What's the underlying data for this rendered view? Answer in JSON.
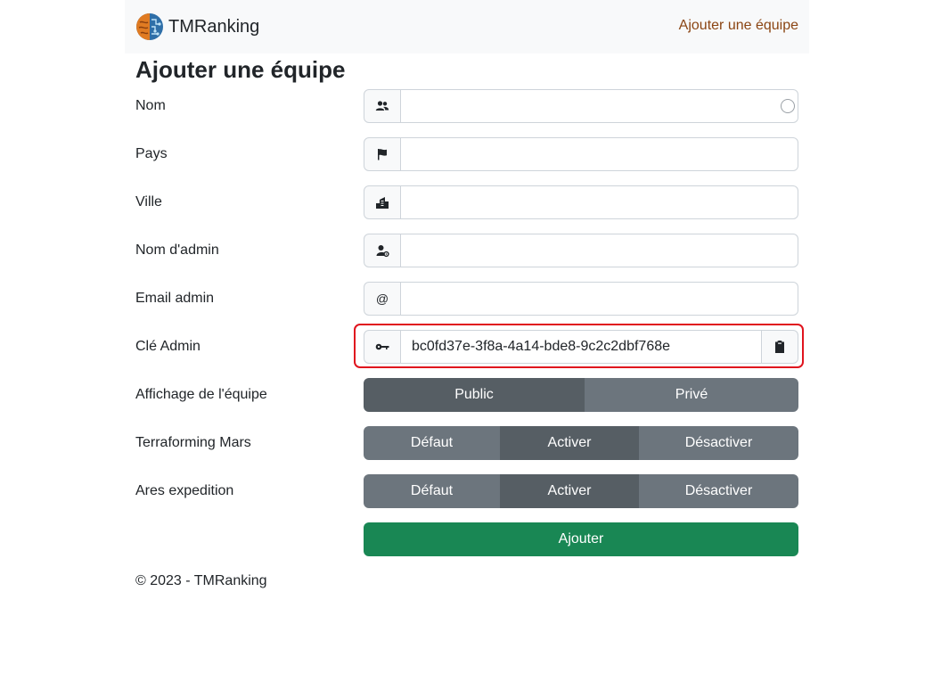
{
  "navbar": {
    "brand_name": "TMRanking",
    "brand_logo_icon": "brain-logo-icon",
    "link_add_team": "Ajouter une équipe"
  },
  "page": {
    "title": "Ajouter une équipe"
  },
  "form": {
    "nom": {
      "label": "Nom",
      "icon": "users-icon",
      "value": ""
    },
    "pays": {
      "label": "Pays",
      "icon": "flag-icon",
      "value": ""
    },
    "ville": {
      "label": "Ville",
      "icon": "city-icon",
      "value": ""
    },
    "admin_name": {
      "label": "Nom d'admin",
      "icon": "user-gear-icon",
      "value": ""
    },
    "admin_email": {
      "label": "Email admin",
      "icon_text": "@",
      "value": ""
    },
    "admin_key": {
      "label": "Clé Admin",
      "icon": "key-icon",
      "value": "bc0fd37e-3f8a-4a14-bde8-9c2c2dbf768e",
      "copy_icon": "clipboard-icon"
    },
    "visibility": {
      "label": "Affichage de l'équipe",
      "options": [
        "Public",
        "Privé"
      ],
      "selected": "Public"
    },
    "terraforming_mars": {
      "label": "Terraforming Mars",
      "options": [
        "Défaut",
        "Activer",
        "Désactiver"
      ],
      "selected": "Activer"
    },
    "ares_expedition": {
      "label": "Ares expedition",
      "options": [
        "Défaut",
        "Activer",
        "Désactiver"
      ],
      "selected": "Activer"
    },
    "submit_label": "Ajouter"
  },
  "colors": {
    "link": "#8b4513",
    "success": "#198754",
    "secondary": "#6c757d",
    "secondary_active": "#565e64",
    "highlight": "#e0141e"
  },
  "footer": {
    "text": "© 2023 - TMRanking"
  }
}
